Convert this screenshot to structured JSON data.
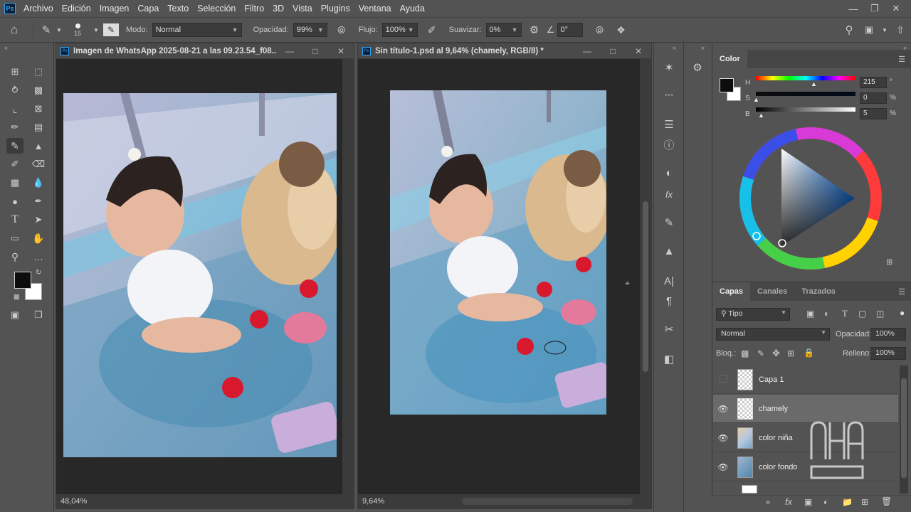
{
  "app": {
    "logo": "Ps"
  },
  "menu": [
    "Archivo",
    "Edición",
    "Imagen",
    "Capa",
    "Texto",
    "Selección",
    "Filtro",
    "3D",
    "Vista",
    "Plugins",
    "Ventana",
    "Ayuda"
  ],
  "options": {
    "brush_size": "15",
    "mode_label": "Modo:",
    "mode_value": "Normal",
    "opacity_label": "Opacidad:",
    "opacity_value": "99%",
    "flow_label": "Flujo:",
    "flow_value": "100%",
    "smooth_label": "Suavizar:",
    "smooth_value": "0%",
    "angle_value": "0°"
  },
  "doc1": {
    "title": "Imagen de WhatsApp 2025-08-21 a las 09.23.54_f08...",
    "zoom": "48,04%"
  },
  "doc2": {
    "title": "Sin título-1.psd al 9,64% (chamely, RGB/8) *",
    "zoom": "9,64%"
  },
  "color_panel": {
    "tab": "Color",
    "h_label": "H",
    "h_value": "215",
    "h_unit": "°",
    "s_label": "S",
    "s_value": "0",
    "s_unit": "%",
    "b_label": "B",
    "b_value": "5",
    "b_unit": "%",
    "foreground": "#0d0d0d",
    "background": "#ffffff"
  },
  "layers_panel": {
    "tabs": [
      "Capas",
      "Canales",
      "Trazados"
    ],
    "filter_value": "Tipo",
    "blend_value": "Normal",
    "opacity_label": "Opacidad:",
    "opacity_value": "100%",
    "lock_label": "Bloq.:",
    "fill_label": "Relleno:",
    "fill_value": "100%",
    "layers": [
      {
        "name": "Capa 1",
        "visible": false,
        "selected": false
      },
      {
        "name": "chamely",
        "visible": true,
        "selected": true
      },
      {
        "name": "color niña",
        "visible": true,
        "selected": false
      },
      {
        "name": "color fondo",
        "visible": true,
        "selected": false
      }
    ]
  },
  "colors": {
    "accent": "#31a8ff",
    "panel": "#535353",
    "dark": "#282828"
  }
}
